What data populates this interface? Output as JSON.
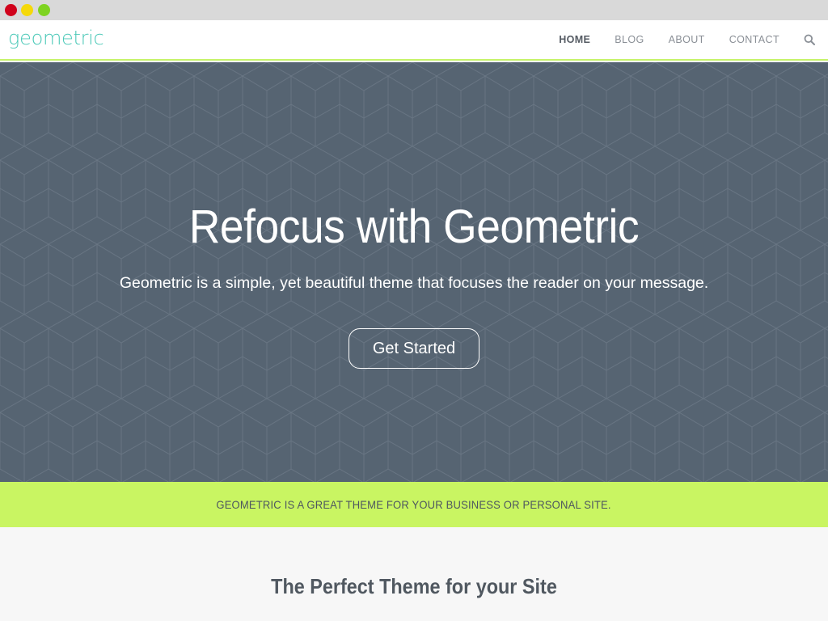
{
  "window": {
    "controls": [
      "close",
      "minimize",
      "maximize"
    ]
  },
  "header": {
    "logo": "geometric",
    "nav": [
      {
        "label": "HOME",
        "active": true
      },
      {
        "label": "BLOG",
        "active": false
      },
      {
        "label": "ABOUT",
        "active": false
      },
      {
        "label": "CONTACT",
        "active": false
      }
    ],
    "search_icon": "search-icon"
  },
  "hero": {
    "title": "Refocus with Geometric",
    "subtitle": "Geometric is a simple, yet beautiful theme that focuses the reader on your message.",
    "button": "Get Started",
    "background_color": "#566472"
  },
  "banner": {
    "text": "GEOMETRIC IS A GREAT THEME FOR YOUR BUSINESS OR PERSONAL SITE.",
    "background_color": "#c9f562"
  },
  "section": {
    "title": "The Perfect Theme for your Site"
  },
  "colors": {
    "accent": "#c6f36a",
    "logo": "#4cc9b8"
  }
}
